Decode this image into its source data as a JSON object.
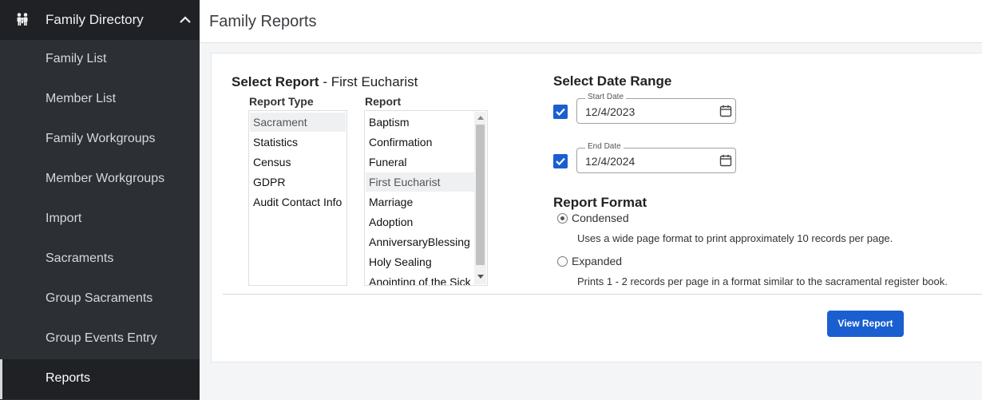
{
  "sidebar": {
    "header": {
      "title": "Family Directory",
      "icon": "family-icon"
    },
    "items": [
      {
        "label": "Family List"
      },
      {
        "label": "Member List"
      },
      {
        "label": "Family Workgroups"
      },
      {
        "label": "Member Workgroups"
      },
      {
        "label": "Import"
      },
      {
        "label": "Sacraments"
      },
      {
        "label": "Group Sacraments"
      },
      {
        "label": "Group Events Entry"
      },
      {
        "label": "Reports"
      }
    ],
    "active": "Reports"
  },
  "header": {
    "title": "Family Reports"
  },
  "select_report": {
    "title_bold": "Select Report",
    "title_rest": " - First Eucharist",
    "report_type_label": "Report Type",
    "report_label": "Report",
    "report_types": [
      "Sacrament",
      "Statistics",
      "Census",
      "GDPR",
      "Audit Contact Info"
    ],
    "selected_type": "Sacrament",
    "reports": [
      "Baptism",
      "Confirmation",
      "Funeral",
      "First Eucharist",
      "Marriage",
      "Adoption",
      "AnniversaryBlessing",
      "Holy Sealing",
      "Anointing of the Sick"
    ],
    "selected_report": "First Eucharist"
  },
  "date_range": {
    "title": "Select Date Range",
    "start": {
      "legend": "Start Date",
      "value": "12/4/2023",
      "checked": true
    },
    "end": {
      "legend": "End Date",
      "value": "12/4/2024",
      "checked": true
    }
  },
  "report_format": {
    "title": "Report Format",
    "options": [
      {
        "label": "Condensed",
        "description": "Uses a wide page format to print approximately 10 records per page.",
        "selected": true
      },
      {
        "label": "Expanded",
        "description": "Prints 1 - 2 records per page in a format similar to the sacramental register book.",
        "selected": false
      }
    ]
  },
  "actions": {
    "view_report": "View Report"
  },
  "colors": {
    "accent": "#1a5fd0",
    "sidebar_bg": "#2c2f33",
    "sidebar_header_bg": "#1f2124"
  }
}
